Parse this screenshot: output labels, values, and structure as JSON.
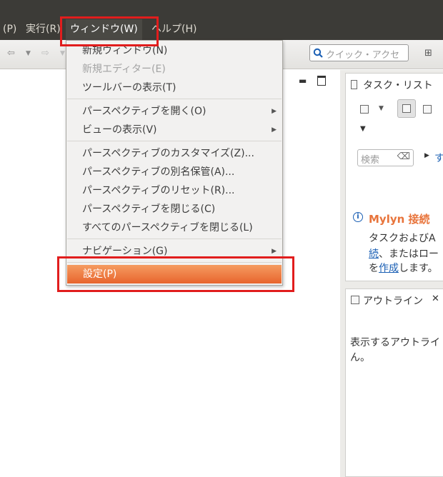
{
  "menubar": {
    "items": [
      "(P)",
      "実行(R)",
      "ウィンドウ(W)",
      "ヘルプ(H)"
    ]
  },
  "toolbar": {
    "quick_access_placeholder": "クイック・アクセ"
  },
  "window_menu": {
    "items": [
      {
        "label": "新規ウィンドウ(N)"
      },
      {
        "label": "新規エディター(E)"
      },
      {
        "label": "ツールバーの表示(T)"
      },
      {
        "label": "パースペクティブを開く(O)"
      },
      {
        "label": "ビューの表示(V)"
      },
      {
        "label": "パースペクティブのカスタマイズ(Z)..."
      },
      {
        "label": "パースペクティブの別名保管(A)..."
      },
      {
        "label": "パースペクティブのリセット(R)..."
      },
      {
        "label": "パースペクティブを閉じる(C)"
      },
      {
        "label": "すべてのパースペクティブを閉じる(L)"
      },
      {
        "label": "ナビゲーション(G)"
      },
      {
        "label": "設定(P)"
      }
    ]
  },
  "task_list": {
    "title": "タスク・リスト",
    "search_placeholder": "検索",
    "clear_glyph": "⌫",
    "link_partial": "す",
    "mylyn": {
      "title": "Mylyn 接続",
      "line1": "タスクおよびA",
      "line2_link": "続",
      "line2_text": "、またはロー",
      "line3_prefix": "を",
      "line3_link": "作成",
      "line3_suffix": "します。"
    }
  },
  "outline": {
    "title": "アウトライン",
    "message_line1": "表示するアウトライ",
    "message_line2": "ん。"
  },
  "colors": {
    "menubar_bg": "#3c3b37",
    "highlight": "#ef7a3f",
    "annotation_red": "#e11d1d"
  }
}
